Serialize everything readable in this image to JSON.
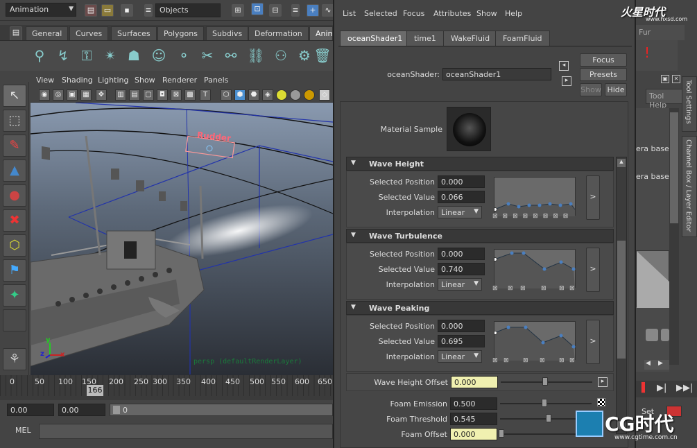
{
  "topbar": {
    "mode": "Animation",
    "selection_mode": "Objects"
  },
  "shelf": {
    "tabs": [
      "General",
      "Curves",
      "Surfaces",
      "Polygons",
      "Subdivs",
      "Deformation",
      "Anim"
    ]
  },
  "viewport": {
    "menu": [
      "View",
      "Shading",
      "Lighting",
      "Show",
      "Renderer",
      "Panels"
    ],
    "label": "Rudder",
    "camera_label": "persp (defaultRenderLayer)",
    "axes": {
      "x": "x",
      "y": "y",
      "z": "z"
    }
  },
  "timeline": {
    "ticks": [
      "0",
      "50",
      "100",
      "150",
      "200",
      "250",
      "300",
      "350",
      "400",
      "450",
      "500",
      "550",
      "600",
      "650"
    ],
    "current": "166"
  },
  "range": {
    "start": "0.00",
    "inner_start": "0.00",
    "anim_start": "0"
  },
  "mel": {
    "label": "MEL"
  },
  "ae": {
    "menu": [
      "List",
      "Selected",
      "Focus",
      "Attributes",
      "Show",
      "Help"
    ],
    "tabs": [
      "oceanShader1",
      "time1",
      "WakeFluid",
      "FoamFluid"
    ],
    "shader_label": "oceanShader:",
    "shader_name": "oceanShader1",
    "buttons": {
      "focus": "Focus",
      "presets": "Presets",
      "show": "Show",
      "hide": "Hide"
    },
    "material_sample_label": "Material Sample",
    "sections": [
      {
        "title": "Wave Height",
        "selected_position": "0.000",
        "selected_value": "0.066",
        "interpolation": "Linear"
      },
      {
        "title": "Wave Turbulence",
        "selected_position": "0.000",
        "selected_value": "0.740",
        "interpolation": "Linear"
      },
      {
        "title": "Wave Peaking",
        "selected_position": "0.000",
        "selected_value": "0.695",
        "interpolation": "Linear"
      }
    ],
    "labels": {
      "selected_position": "Selected Position",
      "selected_value": "Selected Value",
      "interpolation": "Interpolation"
    },
    "wave_height_offset": {
      "label": "Wave Height Offset",
      "value": "0.000"
    },
    "foam_emission": {
      "label": "Foam Emission",
      "value": "0.500"
    },
    "foam_threshold": {
      "label": "Foam Threshold",
      "value": "0.545"
    },
    "foam_offset": {
      "label": "Foam Offset",
      "value": "0.000"
    }
  },
  "right_panel": {
    "tool_settings": "Tool Settings",
    "channel_box": "Channel Box / Layer Editor",
    "tool_help": "Tool Help",
    "fur": "Fur",
    "era_based_1": "era based",
    "era_based_2": "era based",
    "set_label": "Set"
  },
  "watermark": {
    "top": "火星时代",
    "top_url": "www.hxsd.com",
    "bottom": "CG时代",
    "bottom_url": "www.cgtime.com.cn"
  },
  "colors": {
    "accent_blue": "#4a7fc0",
    "yellow_field": "#f0f0b0",
    "section_bg": "#383838"
  }
}
